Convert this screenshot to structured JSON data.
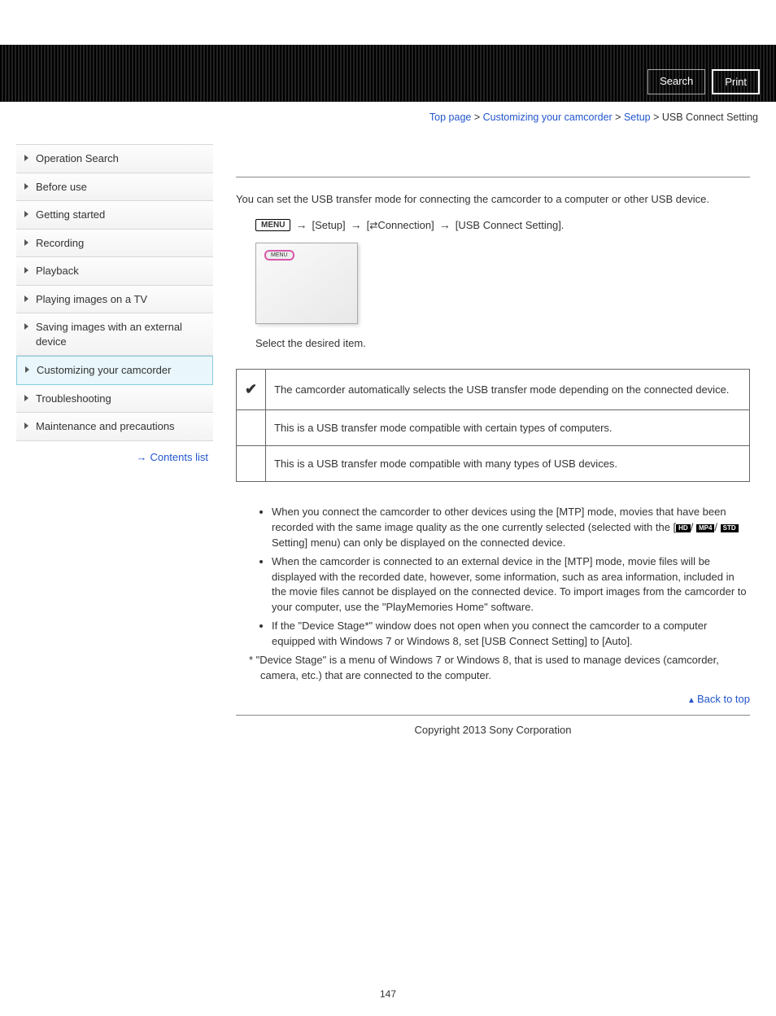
{
  "header": {
    "search": "Search",
    "print": "Print"
  },
  "breadcrumb": {
    "top_page": "Top page",
    "customizing": "Customizing your camcorder",
    "setup": "Setup",
    "current": "USB Connect Setting",
    "sep": " > "
  },
  "sidebar": {
    "items": [
      {
        "label": "Operation Search"
      },
      {
        "label": "Before use"
      },
      {
        "label": "Getting started"
      },
      {
        "label": "Recording"
      },
      {
        "label": "Playback"
      },
      {
        "label": "Playing images on a TV"
      },
      {
        "label": "Saving images with an external device"
      },
      {
        "label": "Customizing your camcorder"
      },
      {
        "label": "Troubleshooting"
      },
      {
        "label": "Maintenance and precautions"
      }
    ],
    "contents_list": "Contents list"
  },
  "main": {
    "intro": "You can set the USB transfer mode for connecting the camcorder to a computer or other USB device.",
    "menu_label": "MENU",
    "step_setup": "[Setup]",
    "step_conn": "Connection]",
    "step_conn_prefix": "[",
    "step_final": "[USB Connect Setting].",
    "device_menu": "MENU",
    "select_text": "Select the desired item.",
    "table": {
      "row1": "The camcorder automatically selects the USB transfer mode depending on the connected device.",
      "row2": "This is a USB transfer mode compatible with certain types of computers.",
      "row3": "This is a USB transfer mode compatible with many types of USB devices.",
      "check": "✔"
    },
    "notes": {
      "n1a": "When you connect the camcorder to other devices using the [MTP] mode, movies that have been recorded with the same image quality as the one currently selected (selected with the [",
      "n1b": "Setting] menu) can only be displayed on the connected device.",
      "fmt1": "HD",
      "fmt2": "MP4",
      "fmt3": "STD",
      "n2": "When the camcorder is connected to an external device in the [MTP] mode, movie files will be displayed with the recorded date, however, some information, such as area information, included in the movie files cannot be displayed on the connected device. To import images from the camcorder to your computer, use the \"PlayMemories Home\" software.",
      "n3": "If the \"Device Stage*\" window does not open when you connect the camcorder to a computer equipped with Windows 7 or Windows 8, set [USB Connect Setting] to [Auto].",
      "footnote": "* \"Device Stage\" is a menu of Windows 7 or Windows 8, that is used to manage devices (camcorder, camera, etc.) that are connected to the computer."
    },
    "back_to_top": "Back to top"
  },
  "footer": {
    "copyright": "Copyright 2013 Sony Corporation",
    "page": "147"
  }
}
